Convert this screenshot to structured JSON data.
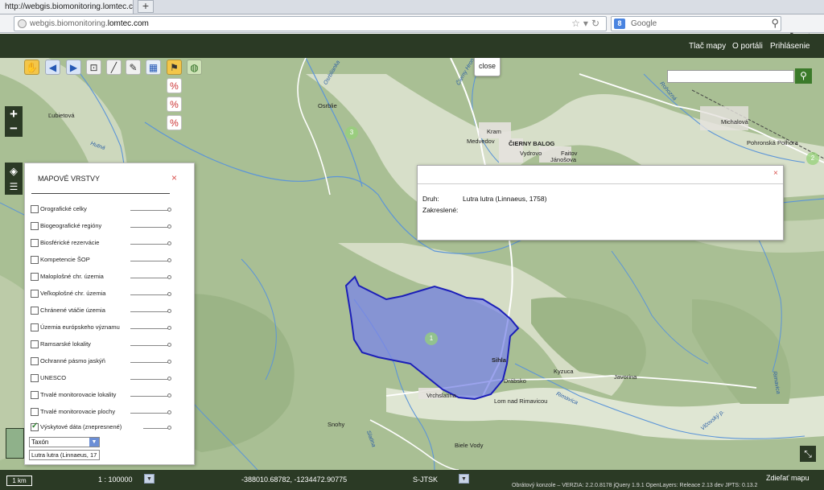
{
  "browser": {
    "tab_title": "http://webgis.biomonitoring.lomtec.com/",
    "new_tab": "+",
    "url_domain_gray": "webgis.biomonitoring.",
    "url_domain_bold": "lomtec.com",
    "search_engine_icon": "8",
    "search_placeholder": "Google"
  },
  "appbar": {
    "links": [
      "Tlač mapy",
      "O portáli",
      "Prihlásenie"
    ]
  },
  "map": {
    "close_popup": "close",
    "zoom_in": "+",
    "zoom_out": "−",
    "labels": {
      "lubietova": "Ľubietová",
      "osrblie": "Osrblie",
      "kram": "Kram",
      "medvedov": "Medvedov",
      "cierny_balog": "ČIERNY BALOG",
      "vydrovo": "Vydrovo",
      "faitov": "Faitov",
      "jangova": "Jánošova",
      "michalova": "Michalová",
      "pohronska": "Pohronská Polhora",
      "sihla": "Sihla",
      "drabsko": "Drábsko",
      "kyzuca": "Kyzuca",
      "javorina": "Javorina",
      "lom": "Lom nad Rimavicou",
      "vrchslatina": "Vrchslatina",
      "snohy": "Snohy",
      "biele_vody": "Biele Vody",
      "osrblianka": "Osrblianka",
      "hutna": "Hutná",
      "cierny_hron": "Čierny Hron",
      "rohozna": "Rohozná",
      "rimavica": "Rimavica",
      "slatina": "Slatina",
      "rimavica2": "Rimavica",
      "vlcovsky": "Vlčovský p."
    },
    "clusters": [
      "3",
      "1",
      "2"
    ]
  },
  "layers_panel": {
    "title": "MAPOVÉ VRSTVY",
    "close": "×",
    "items": [
      {
        "label": "Orografické celky",
        "checked": false
      },
      {
        "label": "Biogeografické regióny",
        "checked": false
      },
      {
        "label": "Biosférické rezervácie",
        "checked": false
      },
      {
        "label": "Kompetencie ŠOP",
        "checked": false
      },
      {
        "label": "Maloplošné chr. územia",
        "checked": false
      },
      {
        "label": "Veľkoplošné chr. územia",
        "checked": false
      },
      {
        "label": "Chránené vtáčie územia",
        "checked": false
      },
      {
        "label": "Územia európskeho významu",
        "checked": false
      },
      {
        "label": "Ramsarské lokality",
        "checked": false
      },
      {
        "label": "Ochranné pásmo jaskýň",
        "checked": false
      },
      {
        "label": "UNESCO",
        "checked": false
      },
      {
        "label": "Trvalé monitorovacie lokality",
        "checked": false
      },
      {
        "label": "Trvalé monitorovacie plochy",
        "checked": false
      },
      {
        "label": "Výskytové dáta (znepresnené)",
        "checked": true
      }
    ],
    "taxon_select": "Taxón",
    "taxon_value": "Lutra lutra (Linnaeus, 17"
  },
  "info_popup": {
    "close": "×",
    "druh_label": "Druh:",
    "druh_value": "Lutra lutra (Linnaeus, 1758)",
    "zakreslene_label": "Zakreslené:"
  },
  "bottombar": {
    "scale_bar": "1 km",
    "scale": "1 : 100000",
    "coordinates": "-388010.68782, -1234472.90775",
    "projection": "S-JTSK",
    "share": "Zdieľať mapu",
    "version": "Obrátový konzole – VERZIA: 2.2.0.8178 jQuery 1.9.1 OpenLayers: Releace 2.13 dev JPTS: 0.13.2"
  },
  "colors": {
    "appbar": "#2b3a25",
    "polygon_fill": "#7b86e8",
    "polygon_stroke": "#1c1fb8",
    "map_hills": "#a8bf92"
  },
  "icons": {
    "pan": "hand-icon",
    "back": "arrow-left-icon",
    "forward": "arrow-right-icon",
    "zoom_box": "zoom-box-icon",
    "measure": "ruler-icon",
    "draw": "draw-icon",
    "identify": "identify-icon",
    "select": "select-icon",
    "globe": "globe-icon"
  }
}
